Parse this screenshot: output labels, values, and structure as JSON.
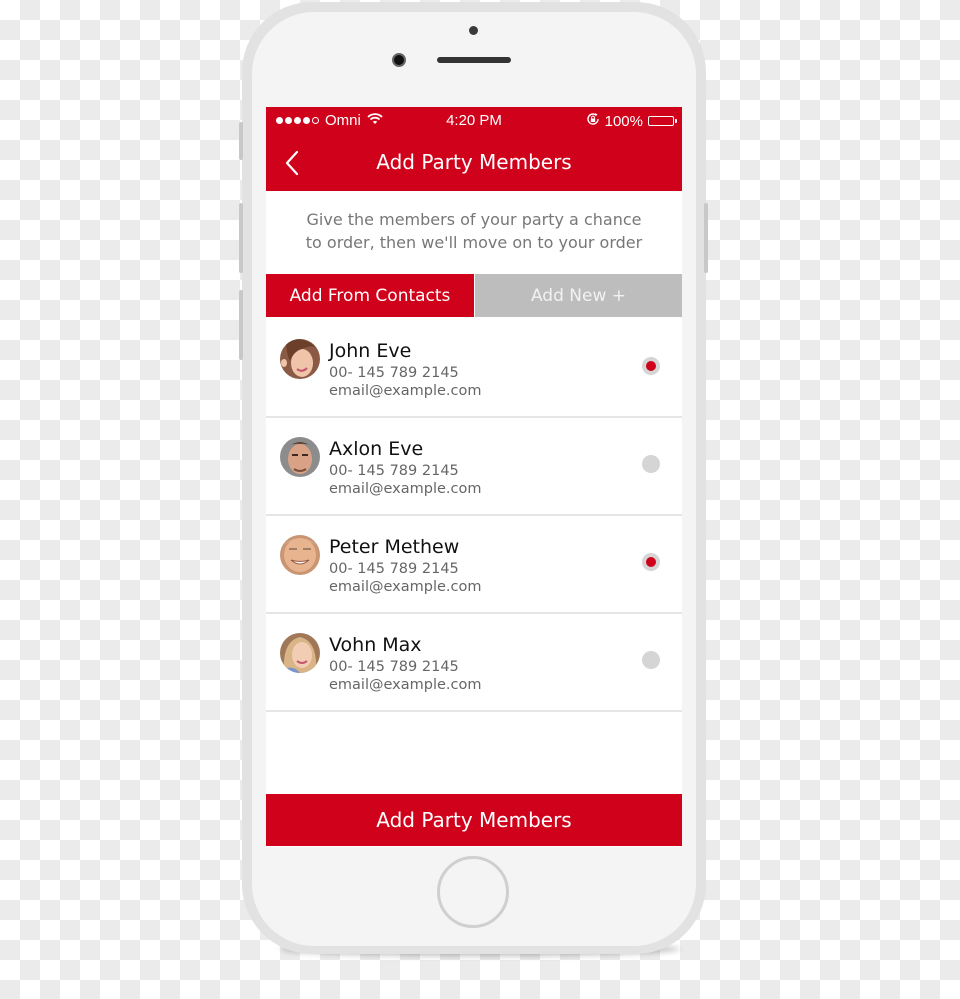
{
  "status_bar": {
    "signal_filled": 4,
    "signal_total": 5,
    "carrier": "Omni",
    "time": "4:20 PM",
    "battery": "100%",
    "battery_level": 1.0
  },
  "nav": {
    "title": "Add Party Members",
    "back_icon": "chevron-left-icon"
  },
  "intro": {
    "line1": "Give the members of your party a chance",
    "line2": "to order, then we'll move on to your order"
  },
  "tabs": [
    {
      "label": "Add From Contacts",
      "active": true
    },
    {
      "label": "Add New +",
      "active": false
    }
  ],
  "contacts": [
    {
      "name": "John Eve",
      "phone": "00- 145 789 2145",
      "email": "email@example.com",
      "selected": true,
      "avatar": "woman-avatar"
    },
    {
      "name": "Axlon Eve",
      "phone": "00- 145 789 2145",
      "email": "email@example.com",
      "selected": false,
      "avatar": "man-avatar"
    },
    {
      "name": "Peter Methew",
      "phone": "00- 145 789 2145",
      "email": "email@example.com",
      "selected": true,
      "avatar": "older-man-avatar"
    },
    {
      "name": "Vohn Max",
      "phone": "00- 145 789 2145",
      "email": "email@example.com",
      "selected": false,
      "avatar": "blonde-woman-avatar"
    }
  ],
  "cta": {
    "label": "Add Party Members"
  },
  "colors": {
    "accent": "#d0021b",
    "tab_inactive": "#bdbdbd",
    "radio_off": "#d5d5d5"
  }
}
